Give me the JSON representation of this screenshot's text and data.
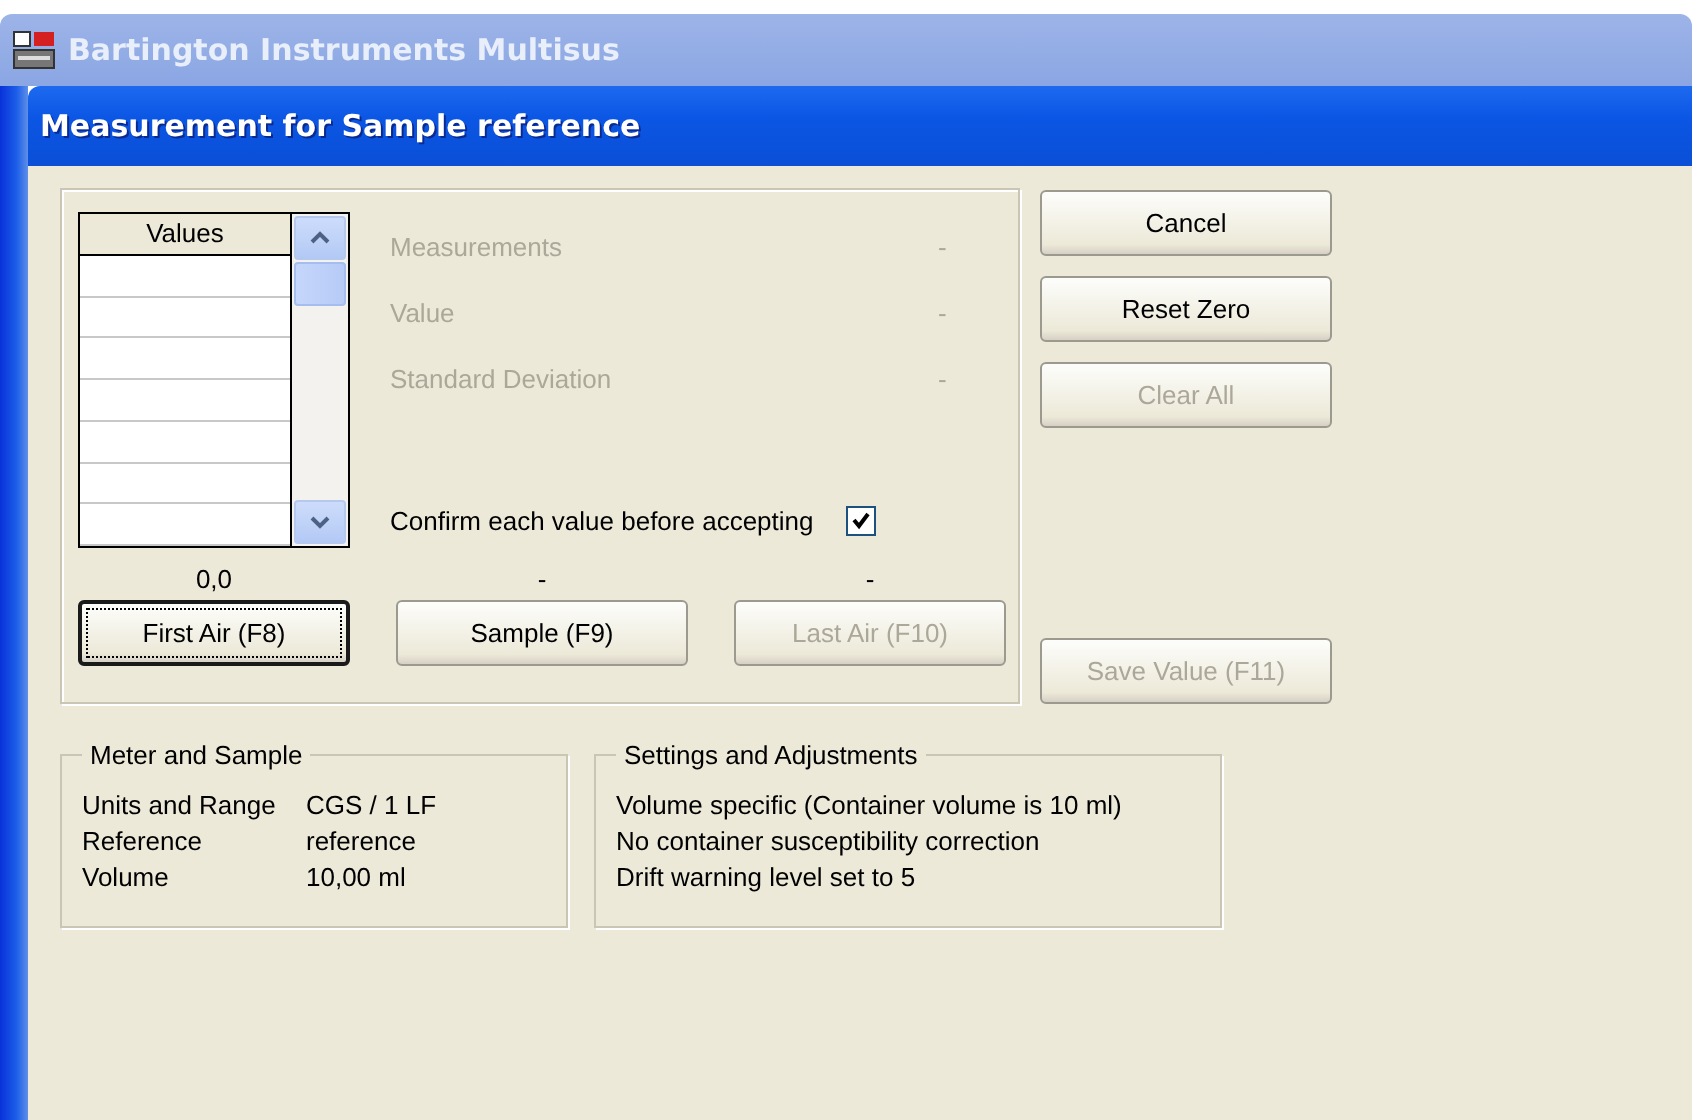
{
  "window": {
    "title": "Bartington Instruments Multisus"
  },
  "dialog": {
    "title": "Measurement for Sample reference"
  },
  "values_table": {
    "header": "Values"
  },
  "stats": [
    {
      "label": "Measurements",
      "value": "-",
      "disabled": true
    },
    {
      "label": "Value",
      "value": "-",
      "disabled": true
    },
    {
      "label": "Standard Deviation",
      "value": "-",
      "disabled": true
    }
  ],
  "confirm": {
    "label": "Confirm each value before accepting",
    "checked": true
  },
  "readings": [
    "0,0",
    "-",
    "-"
  ],
  "measure_buttons": [
    {
      "label": "First Air (F8)",
      "disabled": false,
      "focused": true
    },
    {
      "label": "Sample (F9)",
      "disabled": false,
      "focused": false
    },
    {
      "label": "Last Air (F10)",
      "disabled": true,
      "focused": false
    }
  ],
  "side_buttons": [
    {
      "label": "Cancel",
      "disabled": false
    },
    {
      "label": "Reset Zero",
      "disabled": false
    },
    {
      "label": "Clear All",
      "disabled": true
    }
  ],
  "save_button": {
    "label": "Save Value (F11)",
    "disabled": true
  },
  "meter_and_sample": {
    "title": "Meter and Sample",
    "rows": [
      {
        "label": "Units and Range",
        "value": "CGS / 1 LF"
      },
      {
        "label": "Reference",
        "value": "reference"
      },
      {
        "label": "Volume",
        "value": "10,00 ml"
      }
    ]
  },
  "settings": {
    "title": "Settings and Adjustments",
    "lines": [
      "Volume specific (Container volume is 10 ml)",
      "No container susceptibility correction",
      "Drift warning level set to 5"
    ]
  }
}
